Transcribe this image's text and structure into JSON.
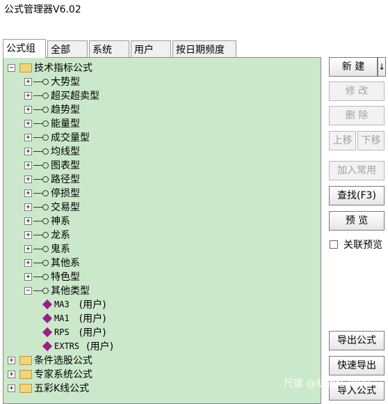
{
  "window": {
    "title": "公式管理器V6.02"
  },
  "tabs": [
    {
      "label": "公式组",
      "active": true
    },
    {
      "label": "全部",
      "active": false
    },
    {
      "label": "系统",
      "active": false
    },
    {
      "label": "用户",
      "active": false
    },
    {
      "label": "按日期频度",
      "active": false
    }
  ],
  "tree": {
    "root": {
      "label": "技术指标公式",
      "expander": "−"
    },
    "groups": [
      {
        "label": "大势型",
        "expander": "+"
      },
      {
        "label": "超买超卖型",
        "expander": "+"
      },
      {
        "label": "趋势型",
        "expander": "+"
      },
      {
        "label": "能量型",
        "expander": "+"
      },
      {
        "label": "成交量型",
        "expander": "+"
      },
      {
        "label": "均线型",
        "expander": "+"
      },
      {
        "label": "图表型",
        "expander": "+"
      },
      {
        "label": "路径型",
        "expander": "+"
      },
      {
        "label": "停损型",
        "expander": "+"
      },
      {
        "label": "交易型",
        "expander": "+"
      },
      {
        "label": "神系",
        "expander": "+"
      },
      {
        "label": "龙系",
        "expander": "+"
      },
      {
        "label": "鬼系",
        "expander": "+"
      },
      {
        "label": "其他系",
        "expander": "+"
      },
      {
        "label": "特色型",
        "expander": "+"
      },
      {
        "label": "其他类型",
        "expander": "−"
      }
    ],
    "formulas": [
      {
        "name": "MA3",
        "owner": "(用户)"
      },
      {
        "name": "MA1",
        "owner": "(用户)"
      },
      {
        "name": "RPS",
        "owner": "(用户)"
      },
      {
        "name": "EXTRS",
        "owner": "(用户)"
      }
    ],
    "other_roots": [
      {
        "label": "条件选股公式",
        "expander": "+"
      },
      {
        "label": "专家系统公式",
        "expander": "+"
      },
      {
        "label": "五彩K线公式",
        "expander": "+"
      }
    ]
  },
  "buttons": {
    "new": "新 建",
    "new_arrow": "↓",
    "modify": "修 改",
    "delete": "删 除",
    "move_up": "上移",
    "move_down": "下移",
    "add_common": "加入常用",
    "find": "查找(F3)",
    "preview": "预 览",
    "export": "导出公式",
    "quick_export": "快速导出",
    "import": "导入公式"
  },
  "linked_preview": {
    "label": "关联预览",
    "checked": false
  },
  "watermark": "尺度 @胡梦跃2008",
  "colors": {
    "tree_bg": "#cbe8cb",
    "gem": "#9b1f8a"
  }
}
